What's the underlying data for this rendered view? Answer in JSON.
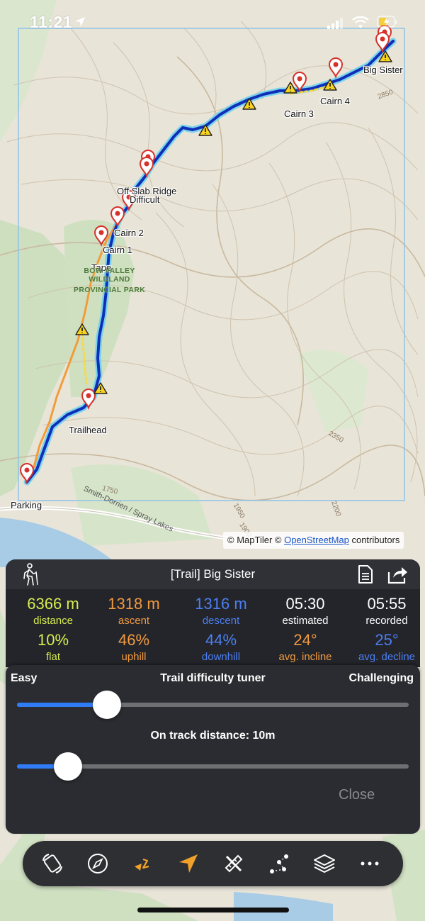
{
  "status_bar": {
    "time": "11:21"
  },
  "map": {
    "labels": {
      "big_sister": "Big Sister",
      "cairn4": "Cairn 4",
      "cairn3": "Cairn 3",
      "off_slab_ridge": "Off Slab Ridge",
      "difficult": "Difficult",
      "cairn2": "Cairn 2",
      "cairn1": "Cairn 1",
      "tape": "Tape",
      "trailhead": "Trailhead",
      "parking": "Parking"
    },
    "park_name": {
      "line1": "BOW VALLEY WILDLAND",
      "line2": "PROVINCIAL PARK"
    },
    "contours": {
      "c2850": "2850",
      "c2350": "2350",
      "c2200": "2200",
      "c1950": "1950",
      "c1900": "1900",
      "c1750": "1750"
    },
    "road": "Smith-Dorrien / Spray Lakes",
    "attribution": {
      "prefix": "© MapTiler © ",
      "osm": "OpenStreetMap",
      "suffix": " contributors"
    }
  },
  "panel": {
    "title": "[Trail] Big Sister",
    "stats_row1": [
      {
        "value": "6366 m",
        "label": "distance",
        "color": "#d7ec4f"
      },
      {
        "value": "1318 m",
        "label": "ascent",
        "color": "#f09a3e"
      },
      {
        "value": "1316 m",
        "label": "descent",
        "color": "#4b7ff0"
      },
      {
        "value": "05:30",
        "label": "estimated",
        "color": "#ffffff"
      },
      {
        "value": "05:55",
        "label": "recorded",
        "color": "#ffffff"
      }
    ],
    "stats_row2": [
      {
        "value": "10%",
        "label": "flat",
        "color": "#d7ec4f"
      },
      {
        "value": "46%",
        "label": "uphill",
        "color": "#f09a3e"
      },
      {
        "value": "44%",
        "label": "downhill",
        "color": "#4b7ff0"
      },
      {
        "value": "24°",
        "label": "avg. incline",
        "color": "#f09a3e"
      },
      {
        "value": "25°",
        "label": "avg. decline",
        "color": "#4b7ff0"
      }
    ]
  },
  "tuner": {
    "easy": "Easy",
    "title": "Trail difficulty tuner",
    "challenging": "Challenging",
    "difficulty_level": 0.23,
    "distance_label": "On track distance: 10m",
    "distance_level": 0.13,
    "close": "Close",
    "accent": "#2f7cf6"
  },
  "toolbar": {
    "icons": [
      "rotate-map-icon",
      "compass-icon",
      "navigate-route-icon",
      "location-arrow-icon",
      "ruler-pencil-icon",
      "waypoints-icon",
      "layers-icon",
      "more-icon"
    ],
    "accent": "#f0a12a"
  }
}
